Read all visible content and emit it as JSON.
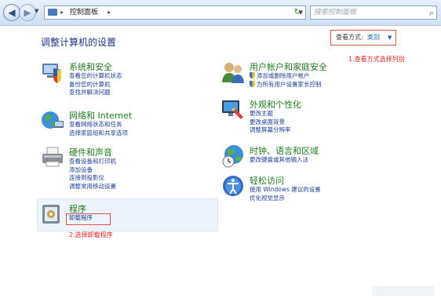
{
  "address": {
    "crumb": "控制面板"
  },
  "search": {
    "placeholder": "搜索控制面板"
  },
  "heading": "调整计算机的设置",
  "view": {
    "label": "查看方式:",
    "value": "类别"
  },
  "notes": {
    "view_note": "1.查看方式选择列别",
    "uninstall_note": "2.选择卸载程序"
  },
  "categories": [
    {
      "title": "系统和安全",
      "icon": "shield-computer-icon",
      "links": [
        "查看您的计算机状态",
        "备份您的计算机",
        "查找并解决问题"
      ]
    },
    {
      "title": "网络和 Internet",
      "icon": "network-icon",
      "links": [
        "查看网络状态和任务",
        "选择家庭组和共享选项"
      ]
    },
    {
      "title": "硬件和声音",
      "icon": "printer-icon",
      "links": [
        "查看设备和打印机",
        "添加设备",
        "连接到投影仪",
        "调整常用移动设置"
      ]
    },
    {
      "title": "程序",
      "icon": "programs-icon",
      "links": [
        "卸载程序"
      ]
    },
    {
      "title": "用户帐户和家庭安全",
      "icon": "users-icon",
      "links": [
        "添加或删除用户帐户",
        "为所有用户设置家长控制"
      ]
    },
    {
      "title": "外观和个性化",
      "icon": "display-icon",
      "links": [
        "更改主题",
        "更改桌面背景",
        "调整屏幕分辨率"
      ]
    },
    {
      "title": "时钟、语言和区域",
      "icon": "globe-clock-icon",
      "links": [
        "更改键盘或其他输入法"
      ]
    },
    {
      "title": "轻松访问",
      "icon": "accessibility-icon",
      "links": [
        "使用 Windows 建议的设置",
        "优化视觉显示"
      ]
    }
  ]
}
